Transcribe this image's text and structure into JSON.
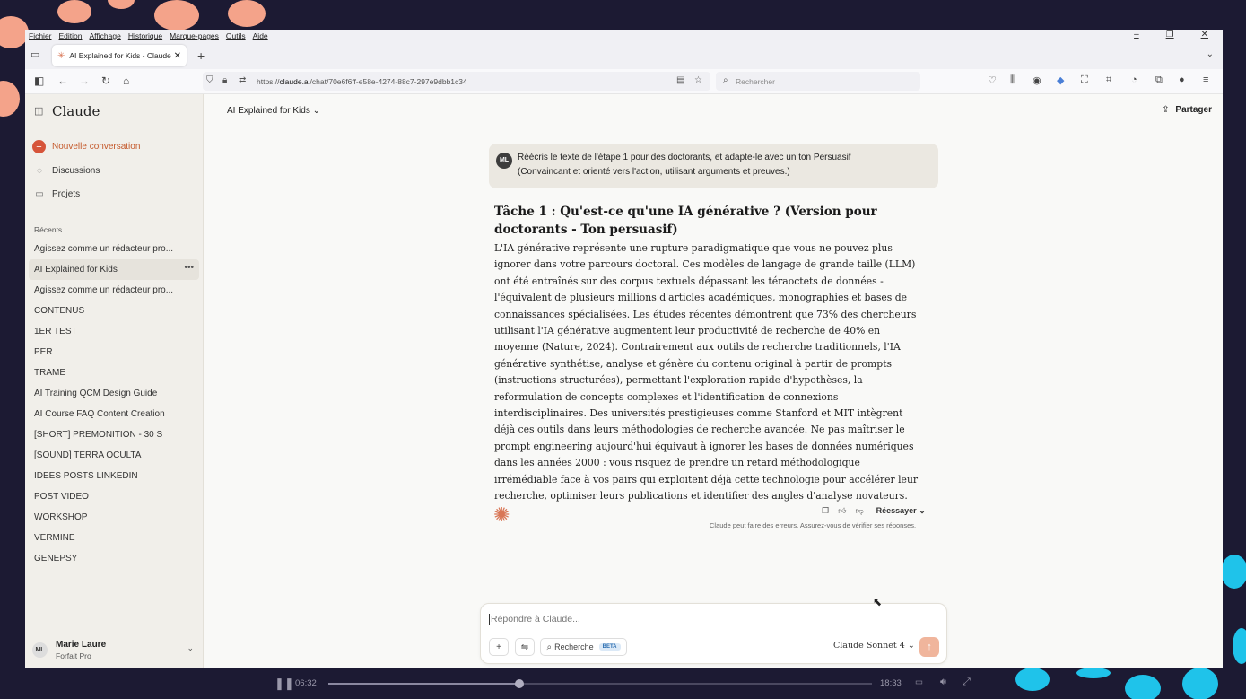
{
  "colors": {
    "accent": "#d97757",
    "new_conv": "#c4582a",
    "send": "#f0b59c"
  },
  "menubar": [
    "Fichier",
    "Edition",
    "Affichage",
    "Historique",
    "Marque-pages",
    "Outils",
    "Aide"
  ],
  "browser": {
    "tab_title": "AI Explained for Kids - Claude",
    "url_prefix": "https://",
    "url_host": "claude.ai",
    "url_path": "/chat/70e6f6ff-e58e-4274-88c7-297e9dbb1c34",
    "search_placeholder": "Rechercher"
  },
  "sidebar": {
    "logo": "Claude",
    "new_conversation": "Nouvelle conversation",
    "nav": [
      {
        "label": "Discussions",
        "icon": "chat-bubble-icon"
      },
      {
        "label": "Projets",
        "icon": "folder-icon"
      }
    ],
    "recents_heading": "Récents",
    "recents": [
      "Agissez comme un rédacteur pro...",
      "AI Explained for Kids",
      "Agissez comme un rédacteur pro...",
      "CONTENUS",
      "1ER TEST",
      "PER",
      "TRAME",
      "AI Training QCM Design Guide",
      "AI Course FAQ Content Creation",
      "[SHORT] PREMONITION - 30 S",
      "[SOUND] TERRA OCULTA",
      "IDEES POSTS LINKEDIN",
      "POST VIDEO",
      "WORKSHOP",
      "VERMINE",
      "GENEPSY"
    ],
    "user": {
      "initials": "ML",
      "name": "Marie Laure",
      "plan": "Forfait Pro"
    }
  },
  "main": {
    "conversation_title": "AI Explained for Kids",
    "share": "Partager",
    "user_message": {
      "initials": "ML",
      "line1": "Réécris le texte de l'étape 1 pour des doctorants, et adapte-le avec un ton Persuasif",
      "line2": "(Convaincant et orienté vers l'action, utilisant arguments et preuves.)"
    },
    "response": {
      "heading": "Tâche 1 : Qu'est-ce qu'une IA générative ? (Version pour doctorants - Ton persuasif)",
      "body": "L'IA générative représente une rupture paradigmatique que vous ne pouvez plus ignorer dans votre parcours doctoral. Ces modèles de langage de grande taille (LLM) ont été entraînés sur des corpus textuels dépassant les téraoctets de données - l'équivalent de plusieurs millions d'articles académiques, monographies et bases de connaissances spécialisées. Les études récentes démontrent que 73% des chercheurs utilisant l'IA générative augmentent leur productivité de recherche de 40% en moyenne (Nature, 2024). Contrairement aux outils de recherche traditionnels, l'IA générative synthétise, analyse et génère du contenu original à partir de prompts (instructions structurées), permettant l'exploration rapide d'hypothèses, la reformulation de concepts complexes et l'identification de connexions interdisciplinaires. Des universités prestigieuses comme Stanford et MIT intègrent déjà ces outils dans leurs méthodologies de recherche avancée. Ne pas maîtriser le prompt engineering aujourd'hui équivaut à ignorer les bases de données numériques dans les années 2000 : vous risquez de prendre un retard méthodologique irrémédiable face à vos pairs qui exploitent déjà cette technologie pour accélérer leur recherche, optimiser leurs publications et identifier des angles d'analyse novateurs."
    },
    "retry": "Réessayer",
    "disclaimer": "Claude peut faire des erreurs. Assurez-vous de vérifier ses réponses.",
    "composer": {
      "placeholder": "Répondre à Claude...",
      "search_label": "Recherche",
      "beta": "BETA",
      "model": "Claude Sonnet 4"
    }
  },
  "video": {
    "elapsed": "06:32",
    "duration": "18:33",
    "progress": 0.352
  }
}
